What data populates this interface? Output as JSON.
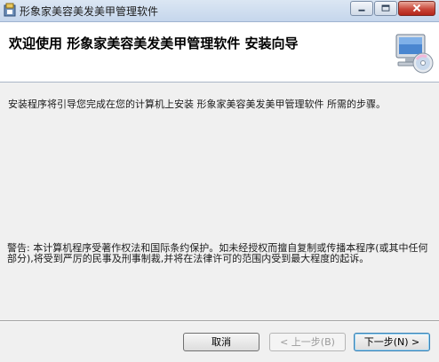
{
  "window": {
    "title": "形象家美容美发美甲管理软件",
    "icons": {
      "app": "installer-icon",
      "minimize": "minimize-icon",
      "maximize": "maximize-icon",
      "close": "close-icon"
    }
  },
  "banner": {
    "title": "欢迎使用 形象家美容美发美甲管理软件 安装向导",
    "icon": "computer-cd-icon"
  },
  "content": {
    "intro": "安装程序将引导您完成在您的计算机上安装 形象家美容美发美甲管理软件 所需的步骤。",
    "warning": "警告: 本计算机程序受著作权法和国际条约保护。如未经授权而擅自复制或传播本程序(或其中任何部分),将受到严厉的民事及刑事制裁,并将在法律许可的范围内受到最大程度的起诉。"
  },
  "buttons": {
    "cancel": "取消",
    "back": "< 上一步(B)",
    "next": "下一步(N) >"
  },
  "colors": {
    "close_button": "#c9473a",
    "default_button_border": "#3c7fb1"
  }
}
